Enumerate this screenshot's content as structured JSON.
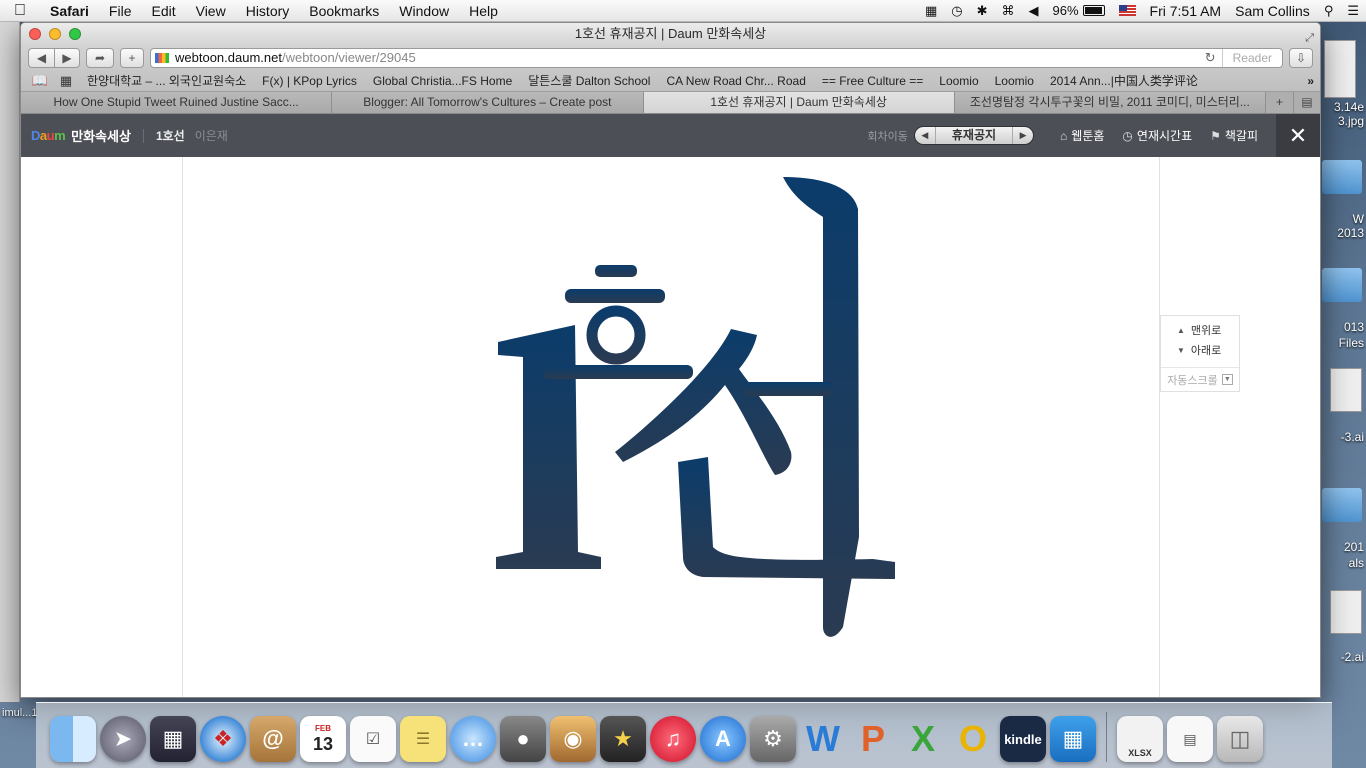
{
  "menubar": {
    "app": "Safari",
    "items": [
      "File",
      "Edit",
      "View",
      "History",
      "Bookmarks",
      "Window",
      "Help"
    ],
    "battery": "96%",
    "clock": "Fri 7:51 AM",
    "user": "Sam Collins"
  },
  "window": {
    "title": "1호선 휴재공지 | Daum 만화속세상"
  },
  "toolbar": {
    "url_host": "webtoon.daum.net",
    "url_path": "/webtoon/viewer/29045",
    "reader_label": "Reader"
  },
  "bookmarks": [
    "한양대학교 – ... 외국인교원숙소",
    "F(x) | KPop Lyrics",
    "Global Christia...FS Home",
    "달튼스쿨 Dalton School",
    "CA New Road Chr... Road",
    "== Free Culture ==",
    "Loomio",
    "Loomio",
    "2014 Ann...|中国人类学评论"
  ],
  "tabs": [
    {
      "label": "How One Stupid Tweet Ruined Justine Sacc...",
      "active": false
    },
    {
      "label": "Blogger: All Tomorrow's Cultures – Create post",
      "active": false
    },
    {
      "label": "1호선 휴재공지 | Daum 만화속세상",
      "active": true
    },
    {
      "label": "조선명탐정 각시투구꽃의 비밀, 2011 코미디, 미스터리...",
      "active": false
    }
  ],
  "webtoon": {
    "logo_brand": "Daum",
    "logo_text": "만화속세상",
    "episode": "1호선",
    "author": "이은재",
    "nav_label": "회차이동",
    "current": "휴재공지",
    "home_label": "웹툰홈",
    "schedule_label": "연재시간표",
    "bookmark_label": "책갈피"
  },
  "comic": {
    "title_small": "1호",
    "title_large": "선"
  },
  "scroll_panel": {
    "top": "맨위로",
    "bottom": "아래로",
    "auto": "자동스크롤"
  },
  "desktop": {
    "labels": [
      "3.14e",
      "3.jpg",
      "W",
      "2013",
      "013",
      "Files",
      "-3.ai",
      "201",
      "als",
      "-2.ai"
    ],
    "bottom_left": "imul...1"
  },
  "dock": {
    "apps": [
      "Finder",
      "Launchpad",
      "Mission Control",
      "Safari",
      "Contacts",
      "Calendar",
      "Reminders",
      "Stickies",
      "Messages",
      "FaceTime",
      "Photo Booth",
      "iMovie",
      "iTunes",
      "App Store",
      "System Preferences",
      "Word",
      "PowerPoint",
      "Excel",
      "Outlook",
      "Kindle",
      "Naver",
      "XLSX",
      "Document",
      "Trash"
    ],
    "calendar_day": "13",
    "calendar_month": "FEB",
    "kindle_label": "kindle",
    "xlsx_label": "XLSX"
  },
  "colors": {
    "header_bg": "#4c4f56",
    "comic_navy_top": "#0b3c6b",
    "comic_navy_bottom": "#2a3b52"
  }
}
